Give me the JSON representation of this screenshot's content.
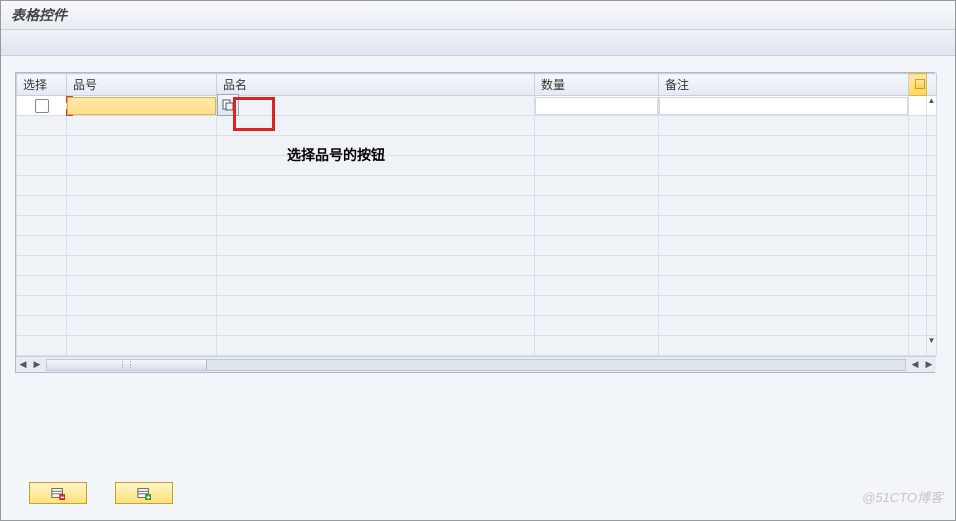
{
  "window": {
    "title": "表格控件"
  },
  "table": {
    "columns": {
      "select": "选择",
      "pno": "品号",
      "pname": "品名",
      "qty": "数量",
      "remark": "备注"
    },
    "rows": [
      {
        "select": false,
        "pno": "",
        "pname": "",
        "qty": "",
        "remark": ""
      }
    ],
    "empty_row_count": 12
  },
  "annotation": {
    "text": "选择品号的按钮"
  },
  "icons": {
    "f4_help": "search-help-icon",
    "config": "table-config-icon",
    "delete_row": "delete-row-icon",
    "insert_row": "insert-row-icon"
  },
  "watermark": "@51CTO博客"
}
